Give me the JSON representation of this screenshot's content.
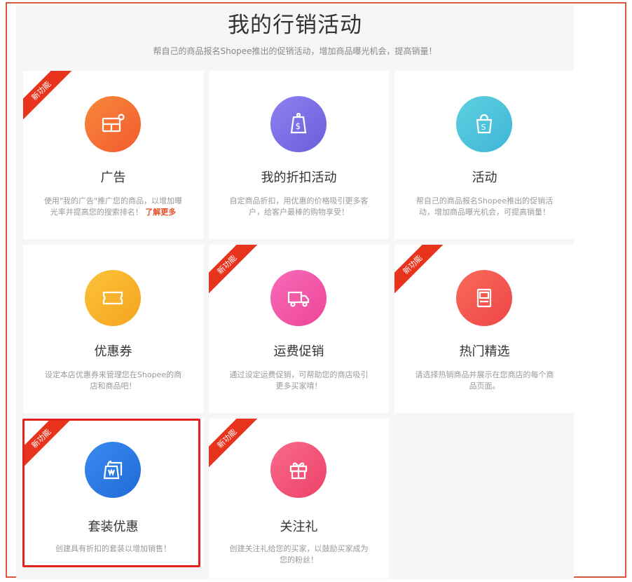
{
  "header": {
    "title": "我的行销活动",
    "subtitle": "帮自己的商品报名Shopee推出的促销活动，增加商品曝光机会，提高销量！"
  },
  "colors": {
    "frame": "#d9573c",
    "ribbon": "#e8341c",
    "highlight": "#e0231d"
  },
  "cards": [
    {
      "title": "广告",
      "desc": "使用\"我的广告\"推广您的商品，以增加曝光率并提高您的搜索排名！",
      "link": "了解更多",
      "badge": "新功能",
      "icon": "ad-icon"
    },
    {
      "title": "我的折扣活动",
      "desc": "自定商品折扣，用优惠的价格吸引更多客户，给客户最棒的购物享受！",
      "icon": "price-tag-icon"
    },
    {
      "title": "活动",
      "desc": "帮自己的商品报名Shopee推出的促销活动，增加商品曝光机会，可提高销量！",
      "icon": "shopping-bag-icon"
    },
    {
      "title": "优惠券",
      "desc": "设定本店优惠券来管理您在Shopee的商店和商品吧！",
      "icon": "ticket-icon"
    },
    {
      "title": "运费促销",
      "desc": "通过设定运费促销，可帮助您的商店吸引更多买家唷！",
      "badge": "新功能",
      "icon": "truck-icon"
    },
    {
      "title": "热门精选",
      "desc": "请选择热销商品并展示在您商店的每个商品页面。",
      "badge": "新功能",
      "icon": "display-icon"
    },
    {
      "title": "套装优惠",
      "desc": "创建具有折扣的套装以增加销售！",
      "badge": "新功能",
      "icon": "bundle-icon"
    },
    {
      "title": "关注礼",
      "desc": "创建关注礼给您的买家，以鼓励买家成为您的粉丝！",
      "badge": "新功能",
      "icon": "gift-icon"
    }
  ]
}
